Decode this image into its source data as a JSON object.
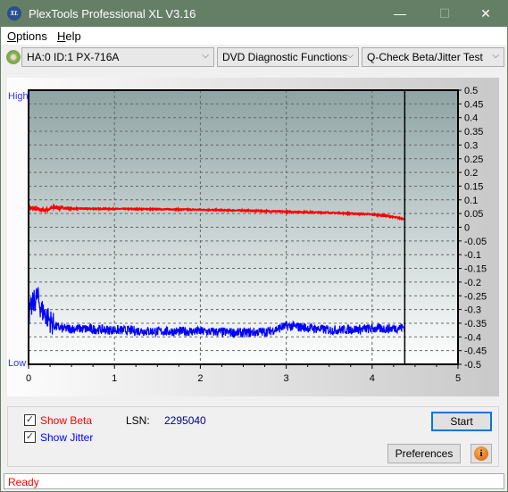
{
  "window": {
    "title": "PlexTools Professional XL V3.16",
    "logo_text": "XL",
    "minimize": "—",
    "maximize": "☐",
    "close": "✕"
  },
  "menu": [
    {
      "label": "Options",
      "u": "O",
      "rest": "ptions"
    },
    {
      "label": "Help",
      "u": "H",
      "rest": "elp"
    }
  ],
  "toolbar": {
    "drive": "HA:0 ID:1  PX-716A",
    "function": "DVD Diagnostic Functions",
    "test": "Q-Check Beta/Jitter Test",
    "arrow": "⌵"
  },
  "chart_data": {
    "type": "line",
    "y_left_labels": {
      "high": "High",
      "low": "Low"
    },
    "xlim": [
      0,
      5
    ],
    "ylim": [
      -0.5,
      0.5
    ],
    "x_ticks": [
      "0",
      "1",
      "2",
      "3",
      "4",
      "5"
    ],
    "y_ticks": [
      "0.5",
      "0.45",
      "0.4",
      "0.35",
      "0.3",
      "0.25",
      "0.2",
      "0.15",
      "0.1",
      "0.05",
      "0",
      "-0.05",
      "-0.1",
      "-0.15",
      "-0.2",
      "-0.25",
      "-0.3",
      "-0.35",
      "-0.4",
      "-0.45",
      "-0.5"
    ],
    "grid": true,
    "marker_x": 4.38,
    "series": [
      {
        "key": "beta",
        "color": "#ff0000",
        "x": [
          0,
          0.1,
          0.2,
          0.3,
          0.5,
          1,
          1.5,
          2,
          2.5,
          3,
          3.5,
          4,
          4.2,
          4.38
        ],
        "y": [
          0.072,
          0.065,
          0.063,
          0.072,
          0.068,
          0.067,
          0.066,
          0.064,
          0.061,
          0.057,
          0.053,
          0.047,
          0.04,
          0.03
        ]
      },
      {
        "key": "jitter",
        "color": "#0000ff",
        "x": [
          0,
          0.05,
          0.1,
          0.15,
          0.2,
          0.3,
          0.4,
          0.6,
          1,
          1.5,
          2,
          2.5,
          2.8,
          3,
          3.2,
          3.5,
          4,
          4.2,
          4.38
        ],
        "y": [
          -0.32,
          -0.28,
          -0.25,
          -0.3,
          -0.32,
          -0.36,
          -0.37,
          -0.37,
          -0.375,
          -0.38,
          -0.38,
          -0.385,
          -0.38,
          -0.36,
          -0.365,
          -0.375,
          -0.37,
          -0.37,
          -0.365
        ]
      }
    ]
  },
  "controls": {
    "show_beta": "Show Beta",
    "show_jitter": "Show Jitter",
    "lsn_label": "LSN:",
    "lsn_value": "2295040",
    "start": "Start",
    "preferences": "Preferences",
    "info": "i",
    "beta_color": "#ff0000",
    "jitter_color": "#0000ff"
  },
  "status": "Ready"
}
